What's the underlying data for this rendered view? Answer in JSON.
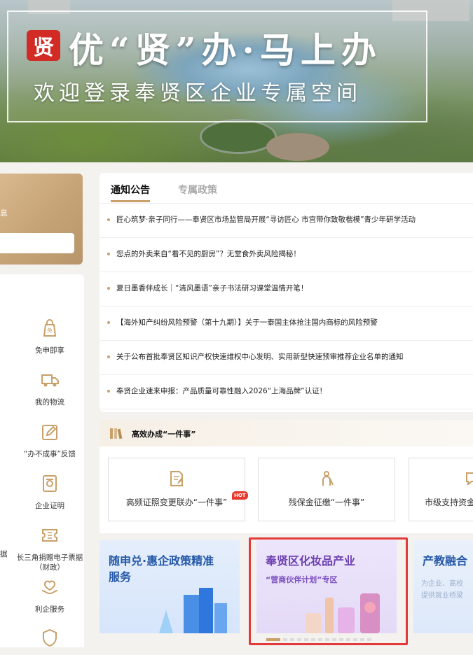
{
  "banner": {
    "seal_char": "贤",
    "title": "优“贤”办·马上办",
    "subtitle": "欢迎登录奉贤区企业专属空间"
  },
  "user_card": {
    "hint": "息"
  },
  "services": [
    {
      "label": "免申即享",
      "icon": "bag-icon"
    },
    {
      "label": "我的物流",
      "icon": "truck-icon"
    },
    {
      "label": "“办不成事”反馈",
      "icon": "edit-icon"
    },
    {
      "label": "企业证明",
      "icon": "certificate-icon"
    },
    {
      "label": "长三角捐赠电子票据（财政）",
      "icon": "ticket-icon"
    },
    {
      "label": "利企服务",
      "icon": "handshake-icon"
    }
  ],
  "service_cut_label": "据",
  "notice": {
    "tabs": [
      "通知公告",
      "专属政策"
    ],
    "active_tab": 0,
    "items": [
      "匠心筑梦·亲子同行——奉贤区市场监管局开展“寻访匠心 市宫带你致敬楷模”青少年研学活动",
      "您点的外卖来自“看不见的厨房”？无堂食外卖风险揭秘！",
      "夏日墨香伴成长｜“清风墨语”亲子书法研习课堂温情开笔！",
      "【海外知产纠纷风险预警（第十九期）】关于一泰国主体抢注国内商标的风险预警",
      "关于公布首批奉贤区知识产权快速维权中心发明、实用新型快速预审推荐企业名单的通知",
      "奉贤企业速来申报：产品质量可靠性融入2026“上海品牌”认证！"
    ]
  },
  "onething": {
    "title": "高效办成“一件事”",
    "cards": [
      {
        "label": "高频证照变更联办“一件事”",
        "hot": "HOT"
      },
      {
        "label": "残保金征缴“一件事”"
      },
      {
        "label": "市级支持资金"
      }
    ]
  },
  "promos": [
    {
      "title": "随申兑·惠企政策精准服务",
      "title_line1": "随申兑·惠企政策精准",
      "title_line2": "服务"
    },
    {
      "title": "奉贤区化妆品产业",
      "subtitle": "“营商伙伴计划”专区"
    },
    {
      "title": "产教融合",
      "desc_line1": "为企业、高校",
      "desc_line2": "提供就业桥梁"
    }
  ],
  "colors": {
    "accent_gold": "#c9a06a",
    "seal_red": "#d22a25",
    "highlight_red": "#e2393b",
    "promo_blue": "#2559a8",
    "promo_purple": "#6d3fb0"
  }
}
